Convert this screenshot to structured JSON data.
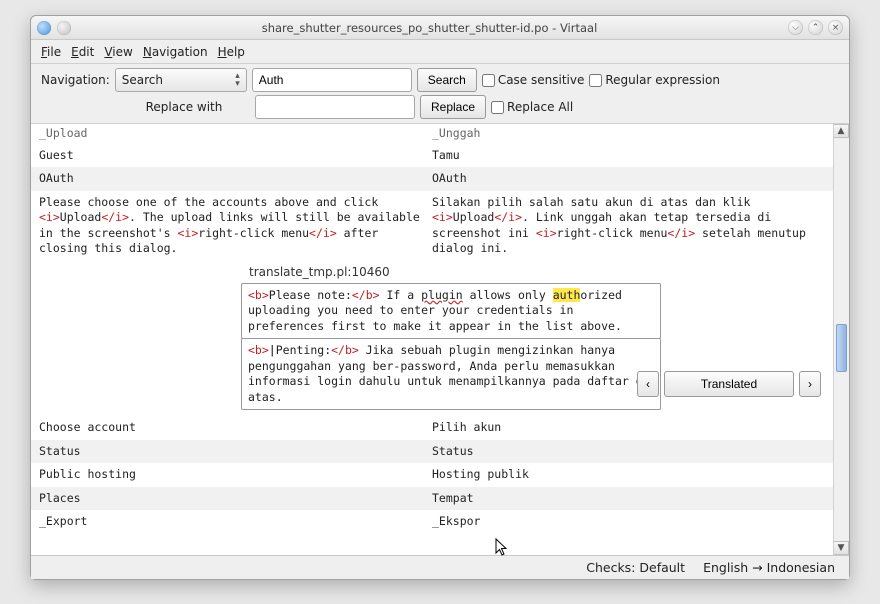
{
  "titlebar": {
    "title": "share_shutter_resources_po_shutter_shutter-id.po - Virtaal"
  },
  "menu": {
    "file": "File",
    "edit": "Edit",
    "view": "View",
    "navigation": "Navigation",
    "help": "Help"
  },
  "toolbar": {
    "nav_label": "Navigation:",
    "mode": "Search",
    "search_value": "Auth",
    "search_btn": "Search",
    "case_label": "Case sensitive",
    "regex_label": "Regular expression",
    "replace_label": "Replace with",
    "replace_value": "",
    "replace_btn": "Replace",
    "replace_all_label": "Replace All"
  },
  "rows": {
    "r0": {
      "src": "_Upload",
      "tgt": "_Unggah"
    },
    "r1": {
      "src": "Guest",
      "tgt": "Tamu"
    },
    "r2": {
      "src": "OAuth",
      "tgt": "OAuth"
    },
    "r3": {
      "src_a": "Please choose one of the accounts above and click ",
      "src_b": "Upload",
      "src_c": ". The upload links will still be available in the screenshot's ",
      "src_d": "right-click menu",
      "src_e": " after closing this dialog.",
      "tgt_a": "Silakan pilih salah satu akun di atas dan klik ",
      "tgt_b": "Upload",
      "tgt_c": ". Link unggah akan tetap tersedia di screenshot ini ",
      "tgt_d": "right-click menu",
      "tgt_e": " setelah menutup dialog ini."
    },
    "r5": {
      "src": "Choose account",
      "tgt": "Pilih akun"
    },
    "r6": {
      "src": "Status",
      "tgt": "Status"
    },
    "r7": {
      "src": "Public hosting",
      "tgt": "Hosting publik"
    },
    "r8": {
      "src": "Places",
      "tgt": "Tempat"
    },
    "r9": {
      "src": "_Export",
      "tgt": "_Ekspor"
    }
  },
  "editor": {
    "location": "translate_tmp.pl:10460",
    "src": {
      "t0": "<b>",
      "t1": "Please note:",
      "t2": "</b>",
      "txt1": " If a ",
      "w_plugin": "plugin",
      "txt2": " allows only ",
      "hl": "auth",
      "txt3": "orized uploading you need to enter your credentials in preferences first to make it appear in the list above."
    },
    "tgt": {
      "t0": "<b>",
      "pipe": "P",
      "t1": "enting:",
      "t2": "</b>",
      "txt": " Jika sebuah plugin mengizinkan hanya pengunggahan yang ber-password, Anda perlu memasukkan informasi login dahulu untuk menampilkannya pada daftar di atas."
    },
    "prev_btn": "‹",
    "translated_btn": "Translated",
    "next_btn": "›"
  },
  "status": {
    "checks": "Checks: Default",
    "langs": "English → Indonesian"
  }
}
